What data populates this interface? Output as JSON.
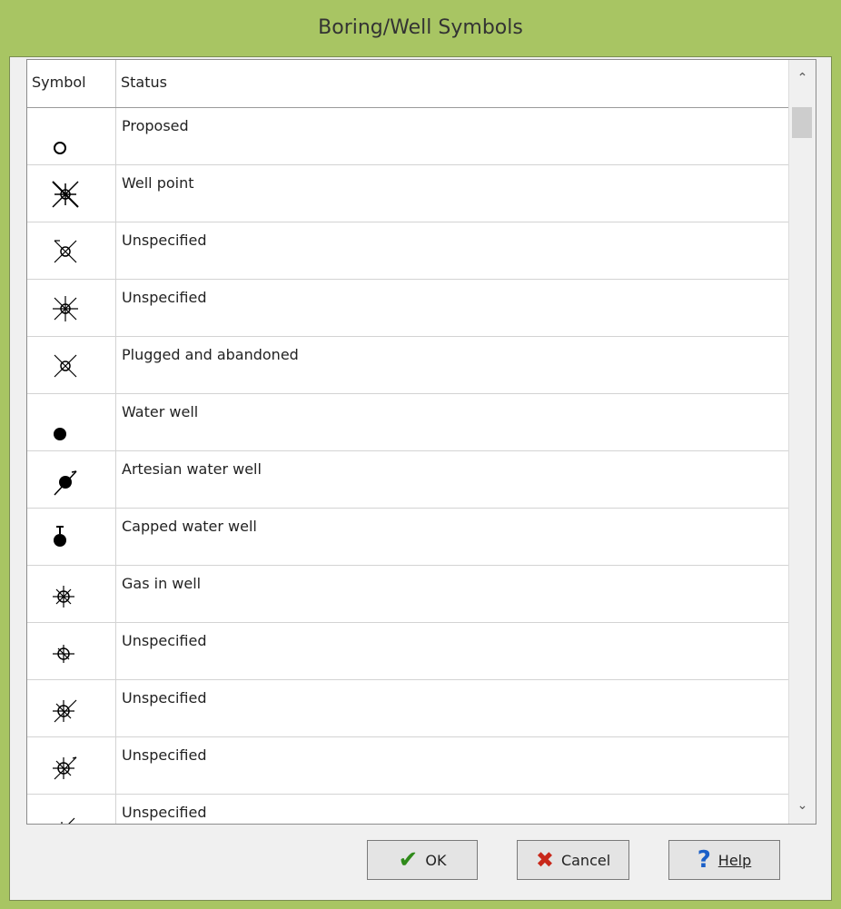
{
  "window": {
    "title": "Boring/Well Symbols"
  },
  "table": {
    "columns": [
      "Symbol",
      "Status"
    ],
    "rows": [
      {
        "symbol": "proposed-circle-icon",
        "status": "Proposed"
      },
      {
        "symbol": "well-point-icon",
        "status": "Well point"
      },
      {
        "symbol": "crossed-circle-icon",
        "status": "Unspecified"
      },
      {
        "symbol": "star-circle-icon",
        "status": "Unspecified"
      },
      {
        "symbol": "plugged-abandoned-icon",
        "status": "Plugged and abandoned"
      },
      {
        "symbol": "water-well-icon",
        "status": "Water well"
      },
      {
        "symbol": "artesian-water-well-icon",
        "status": "Artesian water well"
      },
      {
        "symbol": "capped-water-well-icon",
        "status": "Capped water well"
      },
      {
        "symbol": "gas-in-well-icon",
        "status": "Gas in well"
      },
      {
        "symbol": "gas-variant-icon",
        "status": "Unspecified"
      },
      {
        "symbol": "gas-arrow-icon",
        "status": "Unspecified"
      },
      {
        "symbol": "gas-arrow-variant-icon",
        "status": "Unspecified"
      },
      {
        "symbol": "partial-icon",
        "status": "Unspecified"
      }
    ]
  },
  "buttons": {
    "ok": "OK",
    "cancel": "Cancel",
    "help": "Help"
  }
}
